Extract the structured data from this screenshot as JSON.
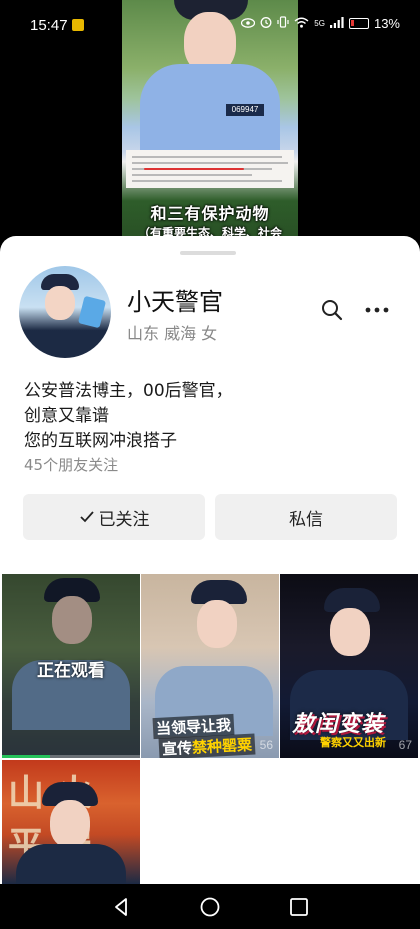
{
  "status_bar": {
    "time": "15:47",
    "network": "5G",
    "battery_percent": "13%",
    "icons": [
      "eye-icon",
      "alarm-icon",
      "vibrate-icon",
      "wifi-icon",
      "signal-icon",
      "battery-icon"
    ]
  },
  "video": {
    "badge": "069947",
    "caption_line1": "和三有保护动物",
    "caption_line2": "（有重要生态、科学、社会"
  },
  "profile": {
    "name": "小天警官",
    "location": "山东 威海 女",
    "bio": [
      "公安普法博主，00后警官，",
      "创意又靠谱",
      "您的互联网冲浪搭子"
    ],
    "followers": "45个朋友关注",
    "follow_button": "已关注",
    "message_button": "私信"
  },
  "grid": {
    "items": [
      {
        "overlay": "正在观看",
        "caption": "",
        "views": ""
      },
      {
        "caption_line1": "当领导让我",
        "caption_line2_plain": "宣传",
        "caption_line2_highlight": "禁种罂粟",
        "views": "56"
      },
      {
        "caption": "敖闰变装",
        "sub_caption": "警察又又出新",
        "views": "67"
      },
      {
        "caption": "山火 平安",
        "views": ""
      }
    ],
    "watching_progress": 0.35
  },
  "colors": {
    "sheet_bg": "#ffffff",
    "button_bg": "#f0f0f0",
    "secondary_text": "#888888",
    "progress": "#25c25a",
    "highlight": "#ffd200"
  }
}
